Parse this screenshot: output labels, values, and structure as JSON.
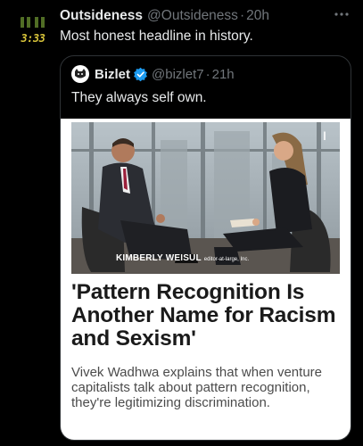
{
  "tweet": {
    "author_name": "Outsideness",
    "handle": "@Outsideness",
    "separator": "·",
    "time": "20h",
    "text": "Most honest headline in history.",
    "avatar_clock_text": "3:33",
    "more_icon": "more-horizontal-icon"
  },
  "quote": {
    "author_name": "Bizlet",
    "handle": "@bizlet7",
    "separator": "·",
    "time": "21h",
    "text": "They always self own.",
    "verified_icon": "verified-badge-icon",
    "verified_color": "#1d9bf0"
  },
  "article": {
    "caption_name": "KIMBERLY WEISUL",
    "caption_role": "editor-at-large, Inc.",
    "headline": "'Pattern Recognition Is Another Name for Racism and Sexism'",
    "dek": "Vivek Wadhwa explains that when venture capitalists talk about pattern recognition, they're legitimizing discrimination."
  },
  "colors": {
    "background": "#000000",
    "primary_text": "#e7e9ea",
    "secondary_text": "#71767b",
    "border": "#2f3336"
  }
}
